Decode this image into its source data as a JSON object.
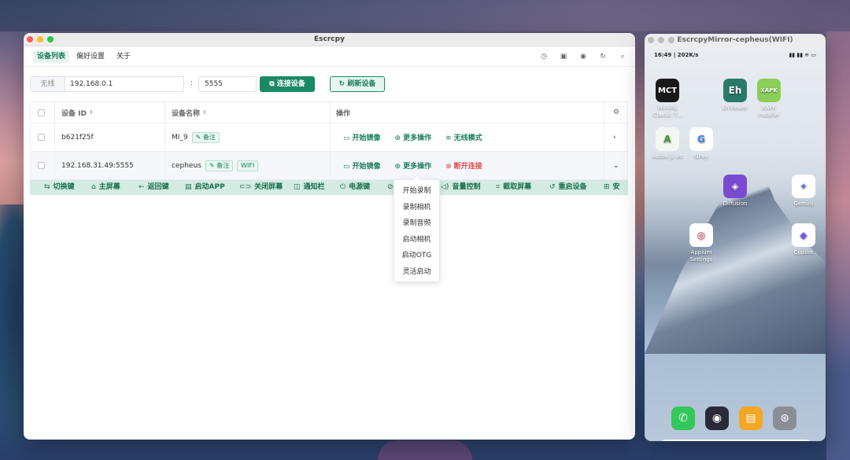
{
  "window": {
    "title": "Escrcpy"
  },
  "menu": {
    "items": [
      "设备列表",
      "偏好设置",
      "关于"
    ]
  },
  "connect": {
    "mode_label": "无线",
    "ip": "192.168.0.1",
    "separator": ":",
    "port": "5555",
    "connect_label": "连接设备",
    "refresh_label": "刷新设备"
  },
  "table": {
    "headers": {
      "id": "设备 ID",
      "name": "设备名称",
      "ops": "操作"
    },
    "rows": [
      {
        "id": "b621f25f",
        "name": "MI_9",
        "note": "备注",
        "tags": [],
        "actions": [
          "开始镜像",
          "更多操作",
          "无线模式"
        ]
      },
      {
        "id": "192.168.31.49:5555",
        "name": "cepheus",
        "note": "备注",
        "tags": [
          "WIFI"
        ],
        "actions": [
          "开始镜像",
          "更多操作",
          "断开连接"
        ]
      }
    ]
  },
  "quickbar": [
    "切换键",
    "主屏幕",
    "返回键",
    "启动APP",
    "关闭屏幕",
    "通知栏",
    "电源键",
    "",
    "音量控制",
    "截取屏幕",
    "重启设备",
    "安"
  ],
  "dropdown": [
    "开始录制",
    "录制相机",
    "录制音频",
    "启动相机",
    "启动OTG",
    "灵活启动"
  ],
  "phone": {
    "title": "EscrcpyMirror-cepheus(WIFI)",
    "status_time": "16:49 | 202K/s",
    "apps": [
      {
        "label": "MIFARE Classic T...",
        "icon": "MCT"
      },
      {
        "label": "EhViewer",
        "icon": "Eh"
      },
      {
        "label": "XAPK Installer",
        "icon": "XAPK"
      },
      {
        "label": "Autox.js v6",
        "icon": "A"
      },
      {
        "label": "GPay",
        "icon": "G"
      },
      {
        "label": "Diffusion",
        "icon": "◈"
      },
      {
        "label": "Gemini",
        "icon": "✦"
      },
      {
        "label": "Appium Settings",
        "icon": "◎"
      },
      {
        "label": "Copilot",
        "icon": "◆"
      }
    ]
  }
}
